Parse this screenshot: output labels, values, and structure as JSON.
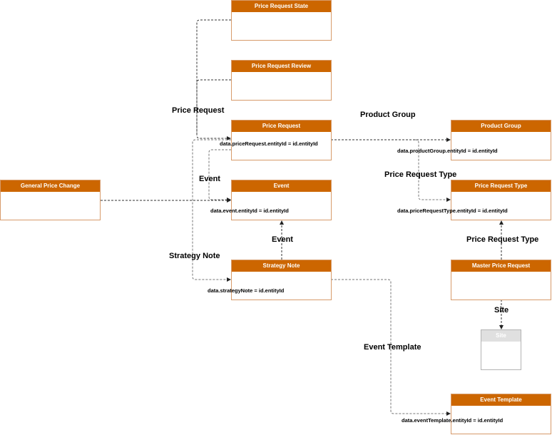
{
  "entities": {
    "price_request_state": {
      "title": "Price Request State"
    },
    "price_request_review": {
      "title": "Price Request Review"
    },
    "price_request": {
      "title": "Price Request"
    },
    "event": {
      "title": "Event"
    },
    "strategy_note": {
      "title": "Strategy Note"
    },
    "general_price_change": {
      "title": "General Price Change"
    },
    "product_group": {
      "title": "Product Group"
    },
    "price_request_type": {
      "title": "Price Request Type"
    },
    "master_price_request": {
      "title": "Master Price Request"
    },
    "site": {
      "title": "Site"
    },
    "event_template": {
      "title": "Event Template"
    }
  },
  "relationship_labels": {
    "price_request": "Price Request",
    "product_group": "Product Group",
    "event_left": "Event",
    "price_request_type": "Price Request Type",
    "event_up": "Event",
    "strategy_note": "Strategy Note",
    "price_request_type_master": "Price Request Type",
    "site": "Site",
    "event_template": "Event Template"
  },
  "join_labels": {
    "price_request": "data.priceRequest.entityId = id.entityId",
    "product_group": "data.productGroup.entityId = id.entityId",
    "price_request_type": "data.priceRequestType.entityId = id.entityId",
    "event": "data.event.entityId = id.entityId",
    "strategy_note": "data.strategyNote = id.entityId",
    "event_template": "data.eventTemplate.entityId = id.entityId"
  },
  "colors": {
    "header": "#cc6600",
    "border": "#d79b6b",
    "inactive_header": "#e0e0e0",
    "edge": "#333333"
  }
}
